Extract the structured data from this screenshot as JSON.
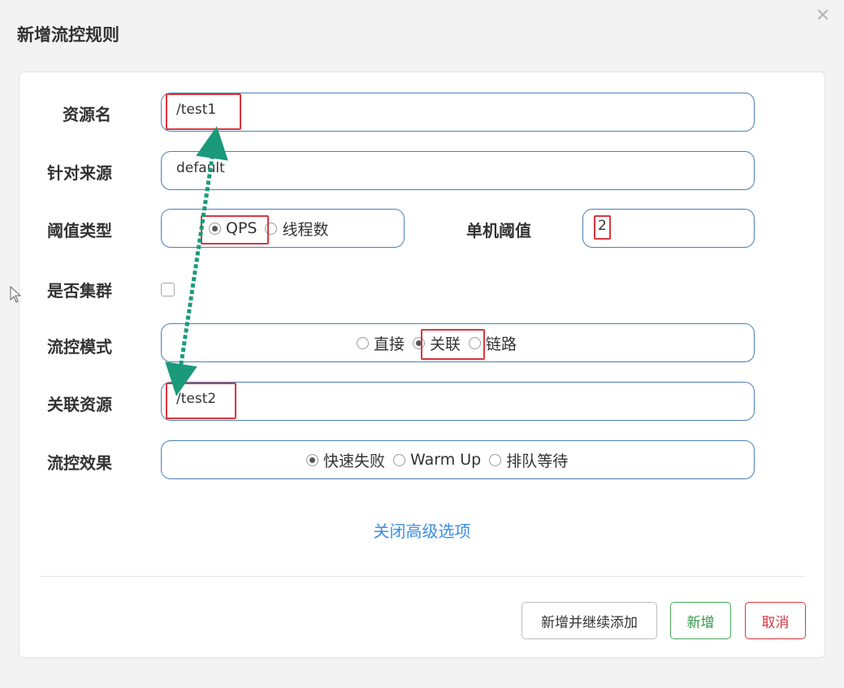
{
  "dialog": {
    "title": "新增流控规则",
    "close_glyph": "✕"
  },
  "form": {
    "resource": {
      "label": "资源名",
      "value": "/test1"
    },
    "source": {
      "label": "针对来源",
      "value": "default"
    },
    "threshold_type": {
      "label": "阈值类型",
      "options": [
        "QPS",
        "线程数"
      ],
      "selected": "QPS"
    },
    "single_threshold": {
      "label": "单机阈值",
      "value": "2"
    },
    "cluster": {
      "label": "是否集群",
      "checked": false
    },
    "control_mode": {
      "label": "流控模式",
      "options": [
        "直接",
        "关联",
        "链路"
      ],
      "selected": "关联"
    },
    "related_resource": {
      "label": "关联资源",
      "value": "/test2"
    },
    "control_effect": {
      "label": "流控效果",
      "options": [
        "快速失败",
        "Warm Up",
        "排队等待"
      ],
      "selected": "快速失败"
    }
  },
  "advanced_toggle": "关闭高级选项",
  "buttons": {
    "add_continue": "新增并继续添加",
    "add": "新增",
    "cancel": "取消"
  },
  "colors": {
    "field_border": "#4d7fb5",
    "highlight": "#d9363e",
    "annotation_arrow": "#1a9a7a",
    "link": "#3a8ee6"
  }
}
